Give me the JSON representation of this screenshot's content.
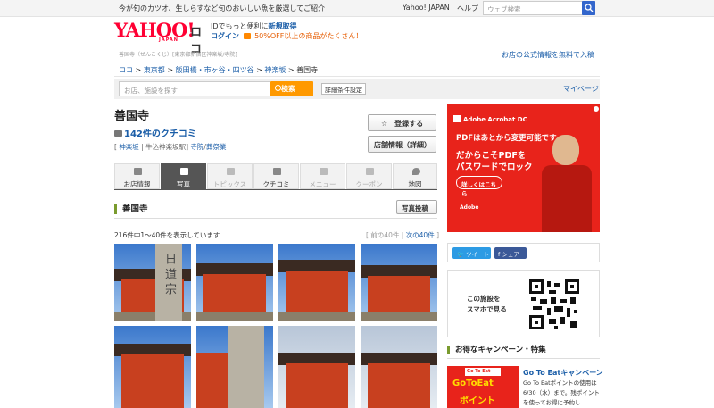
{
  "topbar": {
    "promo": "今が旬のカツオ、生しらすなど旬のおいしい魚を厳選してご紹介",
    "yahoo_japan": "Yahoo! JAPAN",
    "help": "ヘルプ",
    "search_placeholder": "ウェブ検索"
  },
  "header": {
    "logo_text": "YAHOO!",
    "logo_sub": "JAPAN",
    "logo_loco": "ロコ",
    "id_text": "IDでもっと便利に",
    "signup": "新規取得",
    "login": "ログイン",
    "deal": "50%OFF以上の商品がたくさん！",
    "small_info": "善国寺（ぜんこくじ）[東京都新宿区神楽坂/寺院]",
    "official_link": "お店の公式情報を無料で入稿"
  },
  "breadcrumb": [
    "ロコ",
    "東京都",
    "飯田橋・市ヶ谷・四ツ谷",
    "神楽坂",
    "善国寺"
  ],
  "searchbar": {
    "placeholder": "お店、施設を探す",
    "button": "検索",
    "advanced": "詳細条件設定",
    "mypage": "マイページ"
  },
  "place": {
    "name": "善国寺",
    "reviews": "142件のクチコミ",
    "tag_area": "神楽坂",
    "tag_station": "牛込神楽坂駅",
    "tag_cat1": "寺院",
    "tag_cat2": "葬祭業",
    "register_btn": "登録する",
    "info_btn": "店舗情報（詳細）"
  },
  "tabs": [
    {
      "label": "お店情報"
    },
    {
      "label": "写真"
    },
    {
      "label": "トピックス"
    },
    {
      "label": "クチコミ"
    },
    {
      "label": "メニュー"
    },
    {
      "label": "クーポン"
    },
    {
      "label": "地図"
    }
  ],
  "photos": {
    "section_title": "善国寺",
    "post_btn": "写真投稿",
    "count_text": "216件中1〜40件を表示しています",
    "prev": "前の40件",
    "next": "次の40件",
    "captions": [
      "日 道 宗"
    ]
  },
  "ad": {
    "brand": "Adobe Acrobat DC",
    "line1": "PDFはあとから変更可能です。",
    "line2": "だからこそPDFを",
    "line3": "パスワードでロック",
    "cta": "詳しくはこちら",
    "footer": "Adobe"
  },
  "share": {
    "tweet": "ツイート",
    "facebook": "シェア"
  },
  "qr": {
    "line1": "この施設を",
    "line2": "スマホで見る"
  },
  "campaign": {
    "section_title": "お得なキャンペーン・特集",
    "img_badge": "Go To Eat",
    "img_line1": "GoToEat",
    "img_line2": "ポイント",
    "title": "Go To Eatキャンペーン",
    "text": "Go To Eatポイントの使用は6/30（水）まで。残ポイントを使ってお得に予約し"
  },
  "colors": {
    "accent": "#ff9900",
    "link": "#1b5ea8",
    "brand": "#ff0033",
    "ad": "#e8231b"
  }
}
